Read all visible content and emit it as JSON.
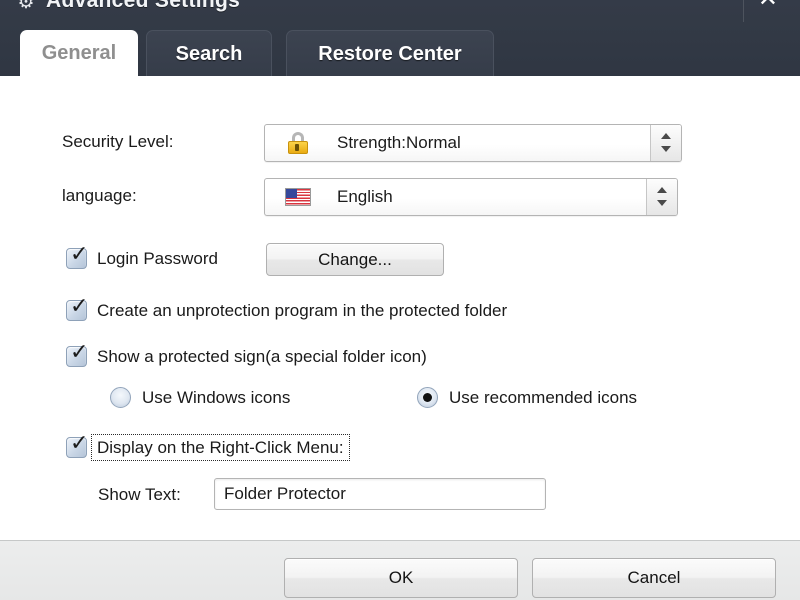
{
  "window": {
    "title": "Advanced Settings",
    "gear_icon": "gear-icon",
    "close_label": "✕"
  },
  "tabs": [
    {
      "label": "General",
      "active": true
    },
    {
      "label": "Search",
      "active": false
    },
    {
      "label": "Restore Center",
      "active": false
    }
  ],
  "form": {
    "security_level": {
      "label": "Security Level:",
      "value": "Strength:Normal",
      "icon": "lock-icon"
    },
    "language": {
      "label": "language:",
      "value": "English",
      "icon": "us-flag-icon"
    },
    "login_password": {
      "label": "Login Password",
      "checked": true,
      "button_label": "Change..."
    },
    "create_unprotection": {
      "label": "Create an unprotection program in the protected folder",
      "checked": true
    },
    "show_protected_sign": {
      "label": "Show a protected sign(a special folder icon)",
      "checked": true
    },
    "icon_style": {
      "options": [
        {
          "label": "Use Windows icons",
          "selected": false
        },
        {
          "label": "Use recommended icons",
          "selected": true
        }
      ]
    },
    "right_click_menu": {
      "label": "Display on the Right-Click Menu:",
      "checked": true,
      "focused": true
    },
    "show_text": {
      "label": "Show Text:",
      "value": "Folder Protector"
    }
  },
  "footer": {
    "ok_label": "OK",
    "cancel_label": "Cancel"
  },
  "colors": {
    "titlebar": "#333a46",
    "tab_inactive": "#3c4350",
    "panel": "#ffffff",
    "footer": "#eceded",
    "lock_gold": "#e9ab13",
    "flag_blue": "#36489b",
    "flag_red": "#d9353f"
  }
}
